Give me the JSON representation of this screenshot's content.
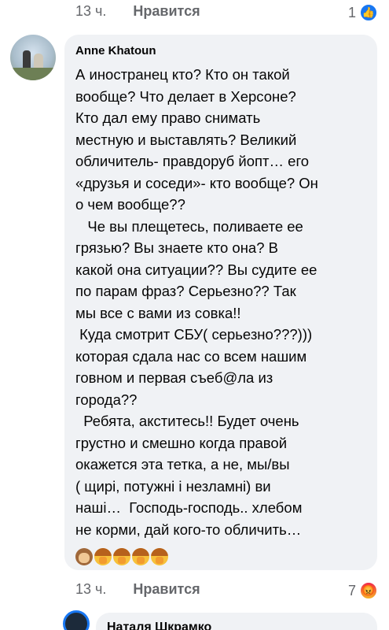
{
  "top_meta": {
    "time": "13 ч.",
    "like": "Нравится",
    "reaction_count": "1"
  },
  "comment": {
    "author": "Anne Khatoun",
    "text": "А иностранец кто? Кто он такой\nвообще? Что делает в Херсоне?\nКто дал ему право снимать\nместную и выставлять? Великий\nобличитель- правдоруб йопт… его\n«друзья и соседи»- кто вообще? Он\nо чем вообще??\n   Че вы плещетесь, поливаете ее\nгрязью? Вы знаете кто она? В\nкакой она ситуации?? Вы судите ее\nпо парам фраз? Серьезно?? Так\nмы все с вами из совка!!\n Куда смотрит СБУ( серьезно???)))\nкоторая сдала нас со всем нашим\nговном и первая съеб@ла из\nгорода??\n  Ребята, акститесь!! Будет очень\nгрустно и смешно когда правой\nокажется эта тетка, а не, мы/вы\n( щирі, потужні і незламні) ви\nнаші…  Господь-господь.. хлебом\nне корми, дай кого-то обличить…",
    "emojis": [
      "see-no-evil-monkey",
      "facepalm-woman",
      "facepalm-woman",
      "facepalm-woman",
      "facepalm-woman"
    ]
  },
  "bottom_meta": {
    "time": "13 ч.",
    "like": "Нравится",
    "reaction_count": "7"
  },
  "reply": {
    "author": "Наталя Шкрамко"
  },
  "colors": {
    "like_blue": "#1877f2",
    "bubble_bg": "#f0f2f5",
    "meta_gray": "#65676b"
  }
}
